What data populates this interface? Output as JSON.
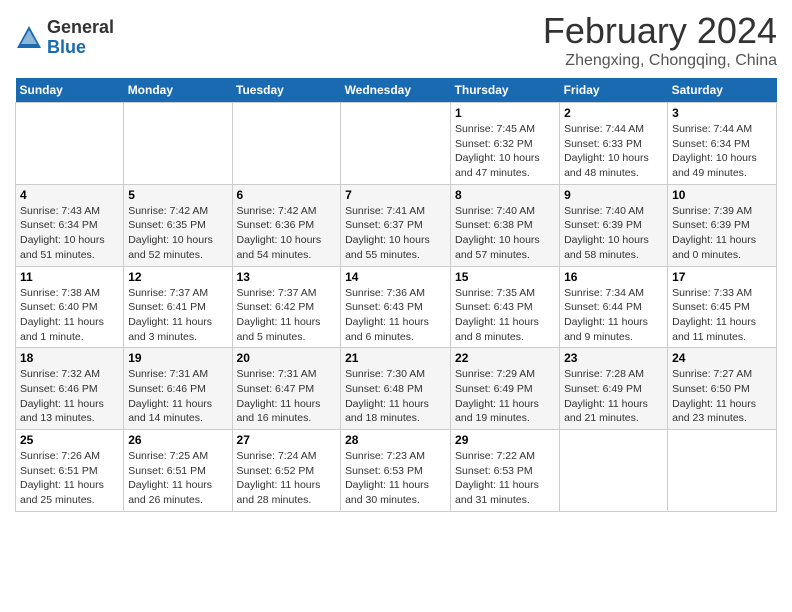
{
  "logo": {
    "general": "General",
    "blue": "Blue"
  },
  "title": "February 2024",
  "location": "Zhengxing, Chongqing, China",
  "days_of_week": [
    "Sunday",
    "Monday",
    "Tuesday",
    "Wednesday",
    "Thursday",
    "Friday",
    "Saturday"
  ],
  "weeks": [
    [
      {
        "day": "",
        "info": ""
      },
      {
        "day": "",
        "info": ""
      },
      {
        "day": "",
        "info": ""
      },
      {
        "day": "",
        "info": ""
      },
      {
        "day": "1",
        "info": "Sunrise: 7:45 AM\nSunset: 6:32 PM\nDaylight: 10 hours\nand 47 minutes."
      },
      {
        "day": "2",
        "info": "Sunrise: 7:44 AM\nSunset: 6:33 PM\nDaylight: 10 hours\nand 48 minutes."
      },
      {
        "day": "3",
        "info": "Sunrise: 7:44 AM\nSunset: 6:34 PM\nDaylight: 10 hours\nand 49 minutes."
      }
    ],
    [
      {
        "day": "4",
        "info": "Sunrise: 7:43 AM\nSunset: 6:34 PM\nDaylight: 10 hours\nand 51 minutes."
      },
      {
        "day": "5",
        "info": "Sunrise: 7:42 AM\nSunset: 6:35 PM\nDaylight: 10 hours\nand 52 minutes."
      },
      {
        "day": "6",
        "info": "Sunrise: 7:42 AM\nSunset: 6:36 PM\nDaylight: 10 hours\nand 54 minutes."
      },
      {
        "day": "7",
        "info": "Sunrise: 7:41 AM\nSunset: 6:37 PM\nDaylight: 10 hours\nand 55 minutes."
      },
      {
        "day": "8",
        "info": "Sunrise: 7:40 AM\nSunset: 6:38 PM\nDaylight: 10 hours\nand 57 minutes."
      },
      {
        "day": "9",
        "info": "Sunrise: 7:40 AM\nSunset: 6:39 PM\nDaylight: 10 hours\nand 58 minutes."
      },
      {
        "day": "10",
        "info": "Sunrise: 7:39 AM\nSunset: 6:39 PM\nDaylight: 11 hours\nand 0 minutes."
      }
    ],
    [
      {
        "day": "11",
        "info": "Sunrise: 7:38 AM\nSunset: 6:40 PM\nDaylight: 11 hours\nand 1 minute."
      },
      {
        "day": "12",
        "info": "Sunrise: 7:37 AM\nSunset: 6:41 PM\nDaylight: 11 hours\nand 3 minutes."
      },
      {
        "day": "13",
        "info": "Sunrise: 7:37 AM\nSunset: 6:42 PM\nDaylight: 11 hours\nand 5 minutes."
      },
      {
        "day": "14",
        "info": "Sunrise: 7:36 AM\nSunset: 6:43 PM\nDaylight: 11 hours\nand 6 minutes."
      },
      {
        "day": "15",
        "info": "Sunrise: 7:35 AM\nSunset: 6:43 PM\nDaylight: 11 hours\nand 8 minutes."
      },
      {
        "day": "16",
        "info": "Sunrise: 7:34 AM\nSunset: 6:44 PM\nDaylight: 11 hours\nand 9 minutes."
      },
      {
        "day": "17",
        "info": "Sunrise: 7:33 AM\nSunset: 6:45 PM\nDaylight: 11 hours\nand 11 minutes."
      }
    ],
    [
      {
        "day": "18",
        "info": "Sunrise: 7:32 AM\nSunset: 6:46 PM\nDaylight: 11 hours\nand 13 minutes."
      },
      {
        "day": "19",
        "info": "Sunrise: 7:31 AM\nSunset: 6:46 PM\nDaylight: 11 hours\nand 14 minutes."
      },
      {
        "day": "20",
        "info": "Sunrise: 7:31 AM\nSunset: 6:47 PM\nDaylight: 11 hours\nand 16 minutes."
      },
      {
        "day": "21",
        "info": "Sunrise: 7:30 AM\nSunset: 6:48 PM\nDaylight: 11 hours\nand 18 minutes."
      },
      {
        "day": "22",
        "info": "Sunrise: 7:29 AM\nSunset: 6:49 PM\nDaylight: 11 hours\nand 19 minutes."
      },
      {
        "day": "23",
        "info": "Sunrise: 7:28 AM\nSunset: 6:49 PM\nDaylight: 11 hours\nand 21 minutes."
      },
      {
        "day": "24",
        "info": "Sunrise: 7:27 AM\nSunset: 6:50 PM\nDaylight: 11 hours\nand 23 minutes."
      }
    ],
    [
      {
        "day": "25",
        "info": "Sunrise: 7:26 AM\nSunset: 6:51 PM\nDaylight: 11 hours\nand 25 minutes."
      },
      {
        "day": "26",
        "info": "Sunrise: 7:25 AM\nSunset: 6:51 PM\nDaylight: 11 hours\nand 26 minutes."
      },
      {
        "day": "27",
        "info": "Sunrise: 7:24 AM\nSunset: 6:52 PM\nDaylight: 11 hours\nand 28 minutes."
      },
      {
        "day": "28",
        "info": "Sunrise: 7:23 AM\nSunset: 6:53 PM\nDaylight: 11 hours\nand 30 minutes."
      },
      {
        "day": "29",
        "info": "Sunrise: 7:22 AM\nSunset: 6:53 PM\nDaylight: 11 hours\nand 31 minutes."
      },
      {
        "day": "",
        "info": ""
      },
      {
        "day": "",
        "info": ""
      }
    ]
  ]
}
